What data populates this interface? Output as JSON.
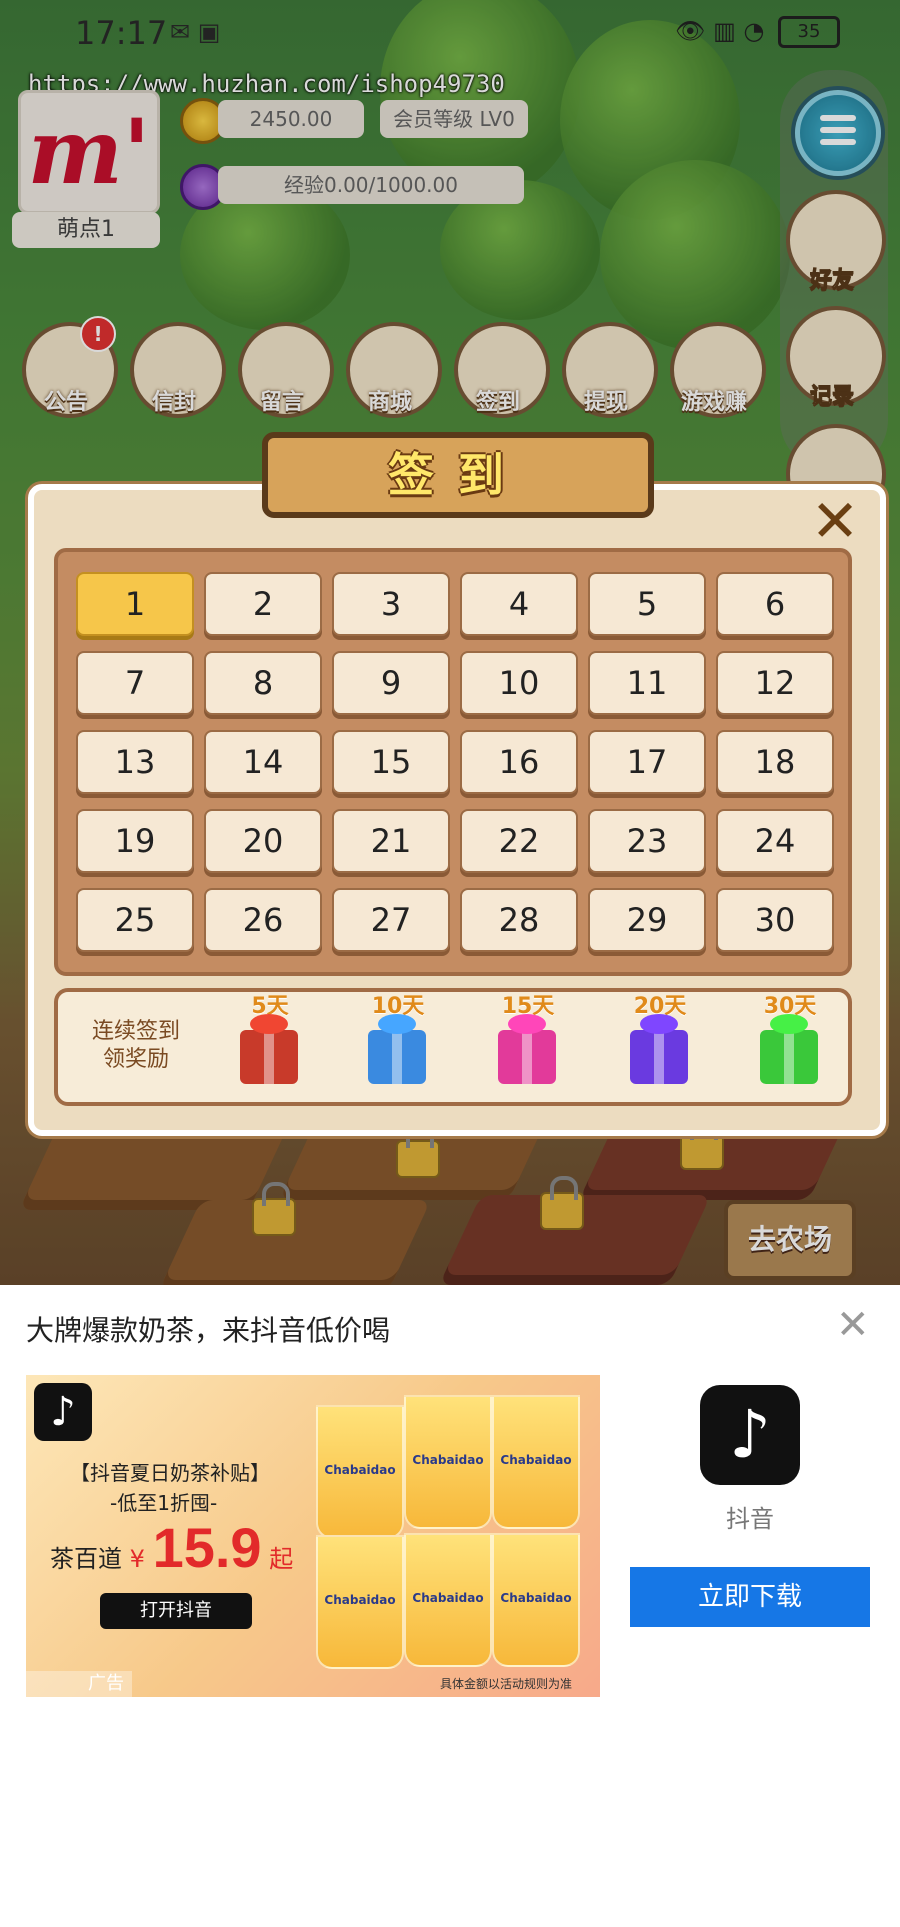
{
  "status_bar": {
    "time": "17:17",
    "battery": "35"
  },
  "watermark_url": "https://www.huzhan.com/ishop49730",
  "profile": {
    "nickname": "萌点1",
    "gold": "2450.00",
    "vip_level": "会员等级 LV0",
    "exp": "经验0.00/1000.00"
  },
  "nav_buttons": [
    {
      "label": "公告",
      "badge": "!"
    },
    {
      "label": "信封"
    },
    {
      "label": "留言"
    },
    {
      "label": "商城"
    },
    {
      "label": "签到"
    },
    {
      "label": "提现"
    },
    {
      "label": "游戏赚"
    }
  ],
  "side_buttons": [
    {
      "label": "好友"
    },
    {
      "label": "记录"
    }
  ],
  "go_farm_label": "去农场",
  "checkin": {
    "title": "签到",
    "close_icon": "close-icon",
    "days": [
      "1",
      "2",
      "3",
      "4",
      "5",
      "6",
      "7",
      "8",
      "9",
      "10",
      "11",
      "12",
      "13",
      "14",
      "15",
      "16",
      "17",
      "18",
      "19",
      "20",
      "21",
      "22",
      "23",
      "24",
      "25",
      "26",
      "27",
      "28",
      "29",
      "30"
    ],
    "active_day": "1",
    "reward_label_line1": "连续签到",
    "reward_label_line2": "领奖励",
    "rewards": [
      {
        "days": "5天",
        "color": "#c83a2a"
      },
      {
        "days": "10天",
        "color": "#3a8ae0"
      },
      {
        "days": "15天",
        "color": "#e23a9a"
      },
      {
        "days": "20天",
        "color": "#6a3ae0"
      },
      {
        "days": "30天",
        "color": "#3ac83a"
      }
    ]
  },
  "ad": {
    "title": "大牌爆款奶茶，来抖音低价喝",
    "banner_line1": "【抖音夏日奶茶补贴】",
    "banner_line2": "-低至1折囤-",
    "brand": "茶百道",
    "currency": "¥",
    "price": "15.9",
    "price_suffix": "起",
    "banner_button": "打开抖音",
    "cup_brand": "Chabaidao",
    "note": "具体金额以活动规则为准",
    "ad_tag": "广告",
    "app_name": "抖音",
    "download_label": "立即下载"
  },
  "colors": {
    "accent_blue": "#1677e6",
    "gold": "#f6c64a"
  }
}
